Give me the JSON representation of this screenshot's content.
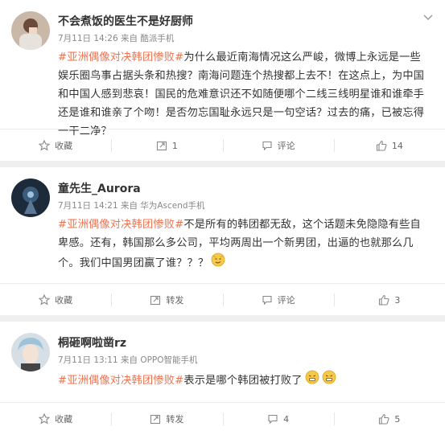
{
  "posts": [
    {
      "username": "不会煮饭的医生不是好厨师",
      "meta": "7月11日 14:26 来自 酷派手机",
      "hashtag": "#亚洲偶像对决韩团惨败#",
      "text": "为什么最近南海情况这么严峻，微博上永远是一些娱乐圈鸟事占据头条和热搜？南海问题连个热搜都上去不！在这点上，为中国和中国人感到悲哀！国民的危难意识还不如随便哪个二线三线明星谁和谁牵手还是谁和谁亲了个吻！是否勿忘国耻永远只是一句空话？过去的痛，已被忘得一干二净？",
      "actions": {
        "favorite": "收藏",
        "repost": "1",
        "comment": "评论",
        "like": "14"
      }
    },
    {
      "username": "童先生_Aurora",
      "meta": "7月11日 14:21 来自 华为Ascend手机",
      "hashtag": "#亚洲偶像对决韩团惨败#",
      "text": "不是所有的韩团都无敌，这个话题未免隐隐有些自卑感。还有，韩国那么多公司，平均两周出一个新男团，出逼的也就那么几个。我们中国男团赢了谁？？？",
      "actions": {
        "favorite": "收藏",
        "repost": "转发",
        "comment": "评论",
        "like": "3"
      }
    },
    {
      "username": "桐砸啊啦凿rz",
      "meta": "7月11日 13:11 来自 OPPO智能手机",
      "hashtag": "#亚洲偶像对决韩团惨败#",
      "text": "表示是哪个韩团被打败了",
      "actions": {
        "favorite": "收藏",
        "repost": "转发",
        "comment": "4",
        "like": "5"
      }
    }
  ],
  "colors": {
    "hashtag": "#eb7350",
    "meta": "#888888",
    "text": "#333333"
  },
  "icons": {
    "favorite": "star-icon",
    "repost": "repost-icon",
    "comment": "comment-icon",
    "like": "thumbs-up-icon",
    "more": "chevron-down-icon"
  }
}
